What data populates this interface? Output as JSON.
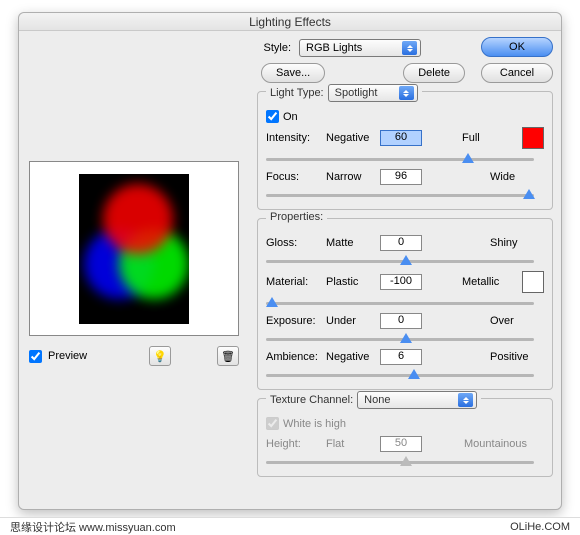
{
  "window": {
    "title": "Lighting Effects"
  },
  "top": {
    "style_label": "Style:",
    "style_value": "RGB Lights",
    "save": "Save...",
    "delete": "Delete",
    "ok": "OK",
    "cancel": "Cancel"
  },
  "lightType": {
    "legend": "Light Type:",
    "value": "Spotlight",
    "on_label": "On",
    "on_checked": true,
    "intensity": {
      "label": "Intensity:",
      "left": "Negative",
      "value": "60",
      "right": "Full",
      "pos": 73
    },
    "focus": {
      "label": "Focus:",
      "left": "Narrow",
      "value": "96",
      "right": "Wide",
      "pos": 96
    },
    "swatch_color": "#ff0000"
  },
  "properties": {
    "legend": "Properties:",
    "gloss": {
      "label": "Gloss:",
      "left": "Matte",
      "value": "0",
      "right": "Shiny",
      "pos": 50
    },
    "material": {
      "label": "Material:",
      "left": "Plastic",
      "value": "-100",
      "right": "Metallic",
      "pos": 0
    },
    "exposure": {
      "label": "Exposure:",
      "left": "Under",
      "value": "0",
      "right": "Over",
      "pos": 50
    },
    "ambience": {
      "label": "Ambience:",
      "left": "Negative",
      "value": "6",
      "right": "Positive",
      "pos": 53
    },
    "swatch_color": "#ffffff"
  },
  "texture": {
    "legend": "Texture Channel:",
    "value": "None",
    "white_is_high": "White is high",
    "height": {
      "label": "Height:",
      "left": "Flat",
      "value": "50",
      "right": "Mountainous",
      "pos": 50
    }
  },
  "preview": {
    "label": "Preview",
    "checked": true
  },
  "footer": {
    "left": "思缘设计论坛  www.missyuan.com",
    "right": "OLiHe.COM"
  }
}
